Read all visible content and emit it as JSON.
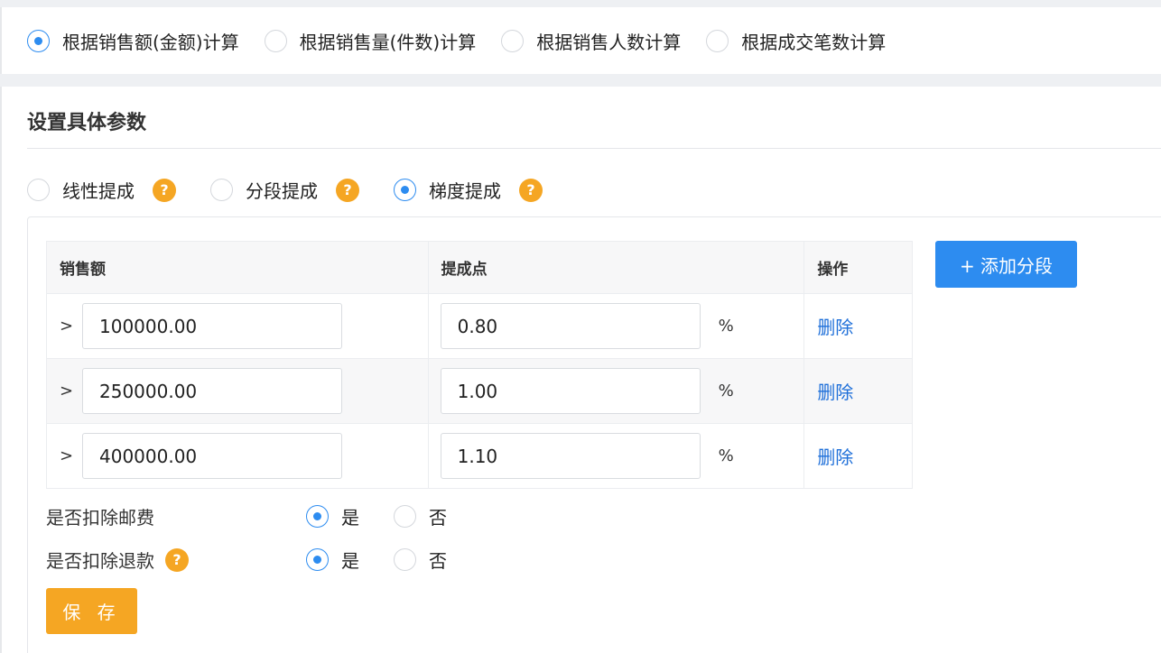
{
  "calc_basis": {
    "options": [
      {
        "label": "根据销售额(金额)计算",
        "checked": true
      },
      {
        "label": "根据销售量(件数)计算",
        "checked": false
      },
      {
        "label": "根据销售人数计算",
        "checked": false
      },
      {
        "label": "根据成交笔数计算",
        "checked": false
      }
    ]
  },
  "params": {
    "title": "设置具体参数",
    "methods": [
      {
        "label": "线性提成",
        "checked": false,
        "help": "?"
      },
      {
        "label": "分段提成",
        "checked": false,
        "help": "?"
      },
      {
        "label": "梯度提成",
        "checked": true,
        "help": "?"
      }
    ]
  },
  "tier_table": {
    "headers": {
      "amount": "销售额",
      "rate": "提成点",
      "action": "操作"
    },
    "rows": [
      {
        "prefix": ">",
        "amount": "100000.00",
        "rate": "0.80",
        "unit": "%",
        "delete": "删除"
      },
      {
        "prefix": ">",
        "amount": "250000.00",
        "rate": "1.00",
        "unit": "%",
        "delete": "删除"
      },
      {
        "prefix": ">",
        "amount": "400000.00",
        "rate": "1.10",
        "unit": "%",
        "delete": "删除"
      }
    ],
    "add_label": "+ 添加分段"
  },
  "deduct_postage": {
    "label": "是否扣除邮费",
    "yes": "是",
    "no": "否",
    "value": "yes"
  },
  "deduct_refund": {
    "label": "是否扣除退款",
    "help": "?",
    "yes": "是",
    "no": "否",
    "value": "yes"
  },
  "save_label": "保 存",
  "colors": {
    "accent": "#2d8cf0",
    "help": "#f5a623",
    "link": "#1e6fd9"
  }
}
